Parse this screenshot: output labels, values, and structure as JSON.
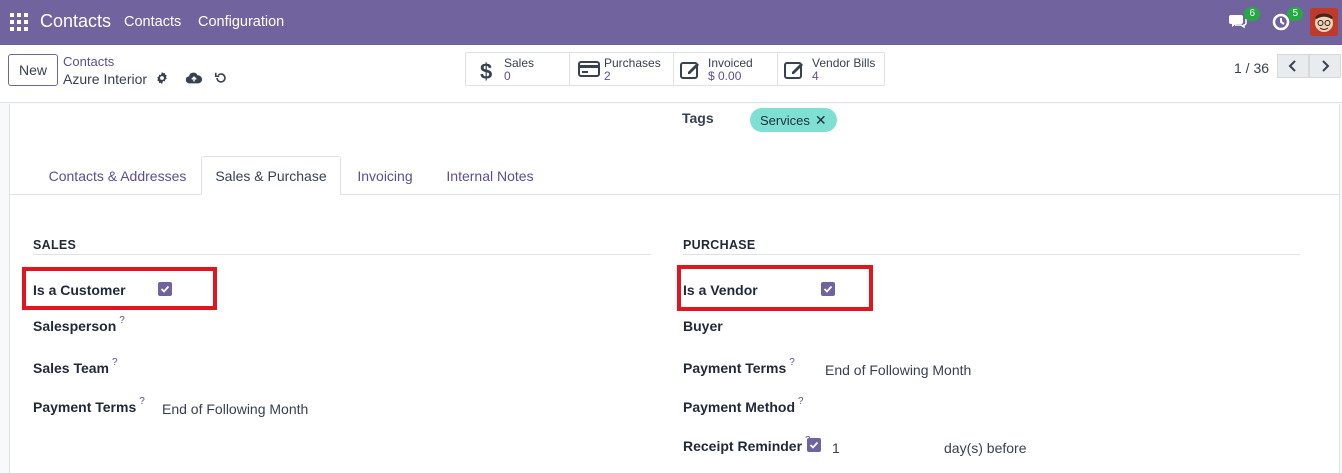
{
  "navbar": {
    "app_name": "Contacts",
    "menu": [
      "Contacts",
      "Configuration"
    ],
    "messages_badge": "6",
    "activities_badge": "5"
  },
  "control_panel": {
    "new_label": "New",
    "breadcrumb_parent": "Contacts",
    "breadcrumb_current": "Azure Interior",
    "pager": "1 / 36"
  },
  "stat_buttons": {
    "sales": {
      "label": "Sales",
      "value": "0",
      "icon": "dollar-icon"
    },
    "purchases": {
      "label": "Purchases",
      "value": "2",
      "icon": "credit-card-icon"
    },
    "invoiced": {
      "label": "Invoiced",
      "value": "$ 0.00",
      "icon": "edit-icon"
    },
    "vendor_bills": {
      "label": "Vendor Bills",
      "value": "4",
      "icon": "edit-icon"
    }
  },
  "tags": {
    "label": "Tags",
    "items": [
      "Services"
    ],
    "tag_color": "#7ee0d3"
  },
  "tabs": [
    "Contacts & Addresses",
    "Sales & Purchase",
    "Invoicing",
    "Internal Notes"
  ],
  "active_tab": "Sales & Purchase",
  "sales": {
    "title": "SALES",
    "is_customer_label": "Is a Customer",
    "is_customer": true,
    "salesperson_label": "Salesperson",
    "sales_team_label": "Sales Team",
    "payment_terms_label": "Payment Terms",
    "payment_terms_value": "End of Following Month"
  },
  "purchase": {
    "title": "PURCHASE",
    "is_vendor_label": "Is a Vendor",
    "is_vendor": true,
    "buyer_label": "Buyer",
    "payment_terms_label": "Payment Terms",
    "payment_terms_value": "End of Following Month",
    "payment_method_label": "Payment Method",
    "receipt_reminder_label": "Receipt Reminder",
    "receipt_reminder_checked": true,
    "receipt_reminder_days": "1",
    "receipt_reminder_suffix": "day(s) before"
  },
  "help_mark": "?",
  "colors": {
    "navbar": "#71639e",
    "accent": "#71639e",
    "highlight": "#e0151f",
    "badge": "#28a745"
  }
}
